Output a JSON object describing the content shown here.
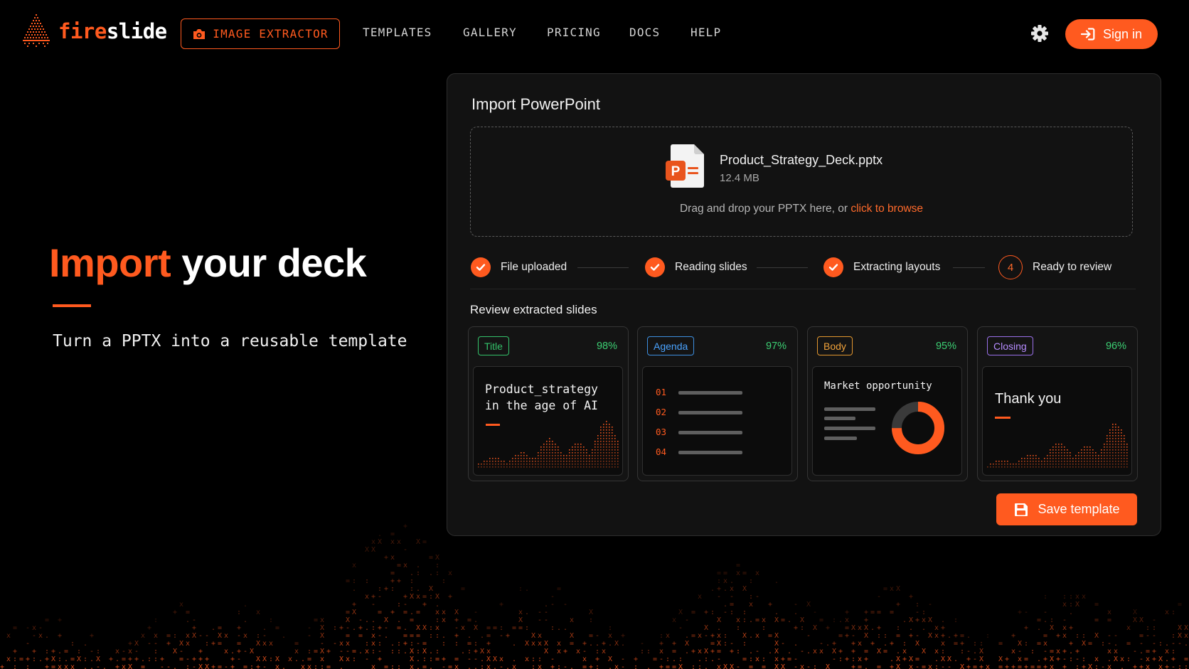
{
  "brand": {
    "part1": "fire",
    "part2": "slide",
    "accent_color": "#ff5a1f"
  },
  "nav": {
    "extractor": "IMAGE EXTRACTOR",
    "links": [
      "TEMPLATES",
      "GALLERY",
      "PRICING",
      "DOCS",
      "HELP"
    ],
    "settings_icon": "gear-icon",
    "signin": "Sign in"
  },
  "hero": {
    "title_accent": "Import",
    "title_rest": " your deck",
    "subtitle": "Turn a PPTX into a reusable template"
  },
  "import": {
    "title": "Import PowerPoint",
    "file_name": "Product_Strategy_Deck.pptx",
    "file_size": "12.4 MB",
    "drop_hint": "Drag and drop your PPTX here, or ",
    "browse": "click to browse",
    "steps": [
      {
        "label": "File uploaded",
        "status": "done"
      },
      {
        "label": "Reading slides",
        "status": "done"
      },
      {
        "label": "Extracting layouts",
        "status": "done"
      },
      {
        "label": "Ready to review",
        "status": "current",
        "number": "4"
      }
    ],
    "review_title": "Review extracted slides",
    "save": "Save template"
  },
  "slides": [
    {
      "tag": "Title",
      "confidence": "98%",
      "line1": "Product_strategy",
      "line2": "in the age of AI"
    },
    {
      "tag": "Agenda",
      "confidence": "97%",
      "items": [
        "01",
        "02",
        "03",
        "04"
      ]
    },
    {
      "tag": "Body",
      "confidence": "95%",
      "heading": "Market opportunity"
    },
    {
      "tag": "Closing",
      "confidence": "96%",
      "heading": "Thank you"
    }
  ]
}
